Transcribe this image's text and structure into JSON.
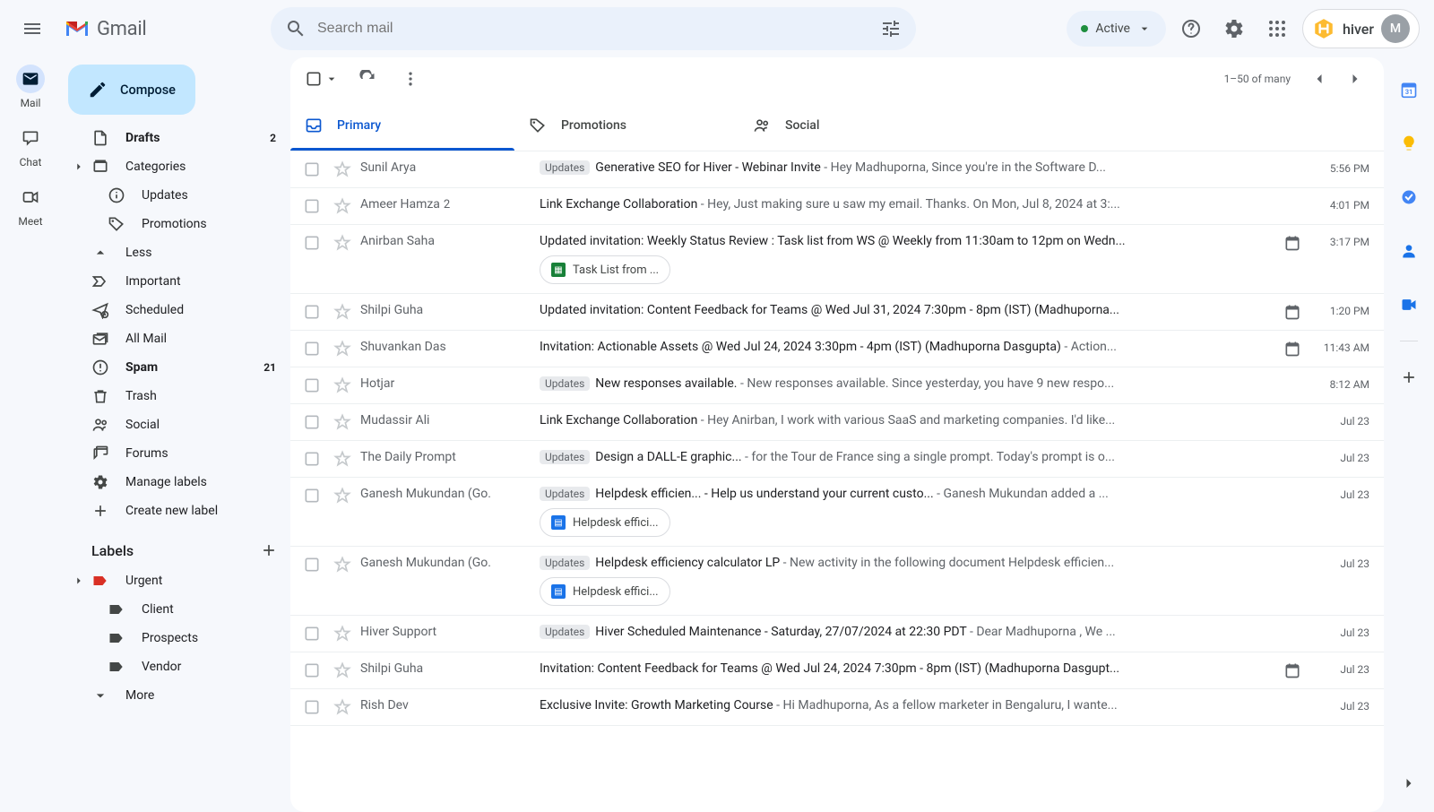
{
  "header": {
    "app_name": "Gmail",
    "search_placeholder": "Search mail",
    "status_label": "Active",
    "hiver_label": "hiver",
    "avatar_initial": "M"
  },
  "appbar": {
    "items": [
      {
        "label": "Mail"
      },
      {
        "label": "Chat"
      },
      {
        "label": "Meet"
      }
    ]
  },
  "compose_label": "Compose",
  "sidebar": {
    "items": [
      {
        "icon": "draft",
        "label": "Drafts",
        "count": "2",
        "bold": true,
        "arrow": "",
        "indent": 0
      },
      {
        "icon": "category",
        "label": "Categories",
        "count": "",
        "bold": false,
        "arrow": "right",
        "indent": 0
      },
      {
        "icon": "info",
        "label": "Updates",
        "count": "",
        "bold": false,
        "arrow": "",
        "indent": 1
      },
      {
        "icon": "tag",
        "label": "Promotions",
        "count": "",
        "bold": false,
        "arrow": "",
        "indent": 1
      },
      {
        "icon": "less",
        "label": "Less",
        "count": "",
        "bold": false,
        "arrow": "",
        "indent": 0
      },
      {
        "icon": "important",
        "label": "Important",
        "count": "",
        "bold": false,
        "arrow": "",
        "indent": 0
      },
      {
        "icon": "scheduled",
        "label": "Scheduled",
        "count": "",
        "bold": false,
        "arrow": "",
        "indent": 0
      },
      {
        "icon": "allmail",
        "label": "All Mail",
        "count": "",
        "bold": false,
        "arrow": "",
        "indent": 0
      },
      {
        "icon": "spam",
        "label": "Spam",
        "count": "21",
        "bold": true,
        "arrow": "",
        "indent": 0
      },
      {
        "icon": "trash",
        "label": "Trash",
        "count": "",
        "bold": false,
        "arrow": "",
        "indent": 0
      },
      {
        "icon": "social",
        "label": "Social",
        "count": "",
        "bold": false,
        "arrow": "",
        "indent": 0
      },
      {
        "icon": "forums",
        "label": "Forums",
        "count": "",
        "bold": false,
        "arrow": "",
        "indent": 0
      },
      {
        "icon": "manage",
        "label": "Manage labels",
        "count": "",
        "bold": false,
        "arrow": "",
        "indent": 0
      },
      {
        "icon": "plus",
        "label": "Create new label",
        "count": "",
        "bold": false,
        "arrow": "",
        "indent": 0
      }
    ],
    "labels_header": "Labels",
    "labels": [
      {
        "icon": "label-red",
        "label": "Urgent",
        "arrow": "right",
        "indent": 0
      },
      {
        "icon": "label",
        "label": "Client",
        "arrow": "",
        "indent": 1
      },
      {
        "icon": "label",
        "label": "Prospects",
        "arrow": "",
        "indent": 1
      },
      {
        "icon": "label",
        "label": "Vendor",
        "arrow": "",
        "indent": 1
      },
      {
        "icon": "more",
        "label": "More",
        "arrow": "",
        "indent": 0
      }
    ]
  },
  "toolbar": {
    "pager": "1–50 of many"
  },
  "tabs": [
    {
      "label": "Primary",
      "icon": "inbox",
      "active": true
    },
    {
      "label": "Promotions",
      "icon": "tag",
      "active": false
    },
    {
      "label": "Social",
      "icon": "people",
      "active": false
    }
  ],
  "updates_badge": "Updates",
  "emails": [
    {
      "sender": "Sunil Arya",
      "count": "",
      "badge": true,
      "subject": "Generative SEO for Hiver - Webinar Invite",
      "snippet": " - Hey Madhuporna, Since you're in the Software D...",
      "cal": false,
      "chip": "",
      "chipType": "",
      "time": "5:56 PM"
    },
    {
      "sender": "Ameer Hamza",
      "count": "2",
      "badge": false,
      "subject": "Link Exchange Collaboration",
      "snippet": " - Hey, Just making sure u saw my email. Thanks. On Mon, Jul 8, 2024 at 3:...",
      "cal": false,
      "chip": "",
      "chipType": "",
      "time": "4:01 PM"
    },
    {
      "sender": "Anirban Saha",
      "count": "",
      "badge": false,
      "subject": "Updated invitation: Weekly Status Review : Task list from WS @ Weekly from 11:30am to 12pm on Wedn...",
      "snippet": "",
      "cal": true,
      "chip": "Task List from ...",
      "chipType": "sheets",
      "time": "3:17 PM"
    },
    {
      "sender": "Shilpi Guha",
      "count": "",
      "badge": false,
      "subject": "Updated invitation: Content Feedback for Teams @ Wed Jul 31, 2024 7:30pm - 8pm (IST) (Madhuporna...",
      "snippet": "",
      "cal": true,
      "chip": "",
      "chipType": "",
      "time": "1:20 PM"
    },
    {
      "sender": "Shuvankan Das",
      "count": "",
      "badge": false,
      "subject": "Invitation: Actionable Assets @ Wed Jul 24, 2024 3:30pm - 4pm (IST) (Madhuporna Dasgupta)",
      "snippet": " - Action...",
      "cal": true,
      "chip": "",
      "chipType": "",
      "time": "11:43 AM"
    },
    {
      "sender": "Hotjar",
      "count": "",
      "badge": true,
      "subject": "New responses available.",
      "snippet": " - New responses available. Since yesterday, you have 9 new respo...",
      "cal": false,
      "chip": "",
      "chipType": "",
      "time": "8:12 AM"
    },
    {
      "sender": "Mudassir Ali",
      "count": "",
      "badge": false,
      "subject": "Link Exchange Collaboration",
      "snippet": " - Hey Anirban, I work with various SaaS and marketing companies. I'd like...",
      "cal": false,
      "chip": "",
      "chipType": "",
      "time": "Jul 23"
    },
    {
      "sender": "The Daily Prompt",
      "count": "",
      "badge": true,
      "subject": "Design a DALL-E graphic...",
      "snippet": " - for the Tour de France sing a single prompt. Today's prompt is o...",
      "cal": false,
      "chip": "",
      "chipType": "",
      "time": "Jul 23"
    },
    {
      "sender": "Ganesh Mukundan (Go.",
      "count": "",
      "badge": true,
      "subject": "Helpdesk efficien... - Help us understand your current custo...",
      "snippet": " - Ganesh Mukundan added a ...",
      "cal": false,
      "chip": "Helpdesk effici...",
      "chipType": "docs",
      "time": "Jul 23"
    },
    {
      "sender": "Ganesh Mukundan (Go.",
      "count": "",
      "badge": true,
      "subject": "Helpdesk efficiency calculator LP",
      "snippet": " - New activity in the following document Helpdesk efficien...",
      "cal": false,
      "chip": "Helpdesk effici...",
      "chipType": "docs",
      "time": "Jul 23"
    },
    {
      "sender": "Hiver Support",
      "count": "",
      "badge": true,
      "subject": "Hiver Scheduled Maintenance - Saturday, 27/07/2024 at 22:30 PDT",
      "snippet": " - Dear Madhuporna , We ...",
      "cal": false,
      "chip": "",
      "chipType": "",
      "time": "Jul 23"
    },
    {
      "sender": "Shilpi Guha",
      "count": "",
      "badge": false,
      "subject": "Invitation: Content Feedback for Teams @ Wed Jul 24, 2024 7:30pm - 8pm (IST) (Madhuporna Dasgupt...",
      "snippet": "",
      "cal": true,
      "chip": "",
      "chipType": "",
      "time": "Jul 23"
    },
    {
      "sender": "Rish Dev",
      "count": "",
      "badge": false,
      "subject": "Exclusive Invite: Growth Marketing Course",
      "snippet": " - Hi Madhuporna, As a fellow marketer in Bengaluru, I wante...",
      "cal": false,
      "chip": "",
      "chipType": "",
      "time": "Jul 23"
    }
  ]
}
